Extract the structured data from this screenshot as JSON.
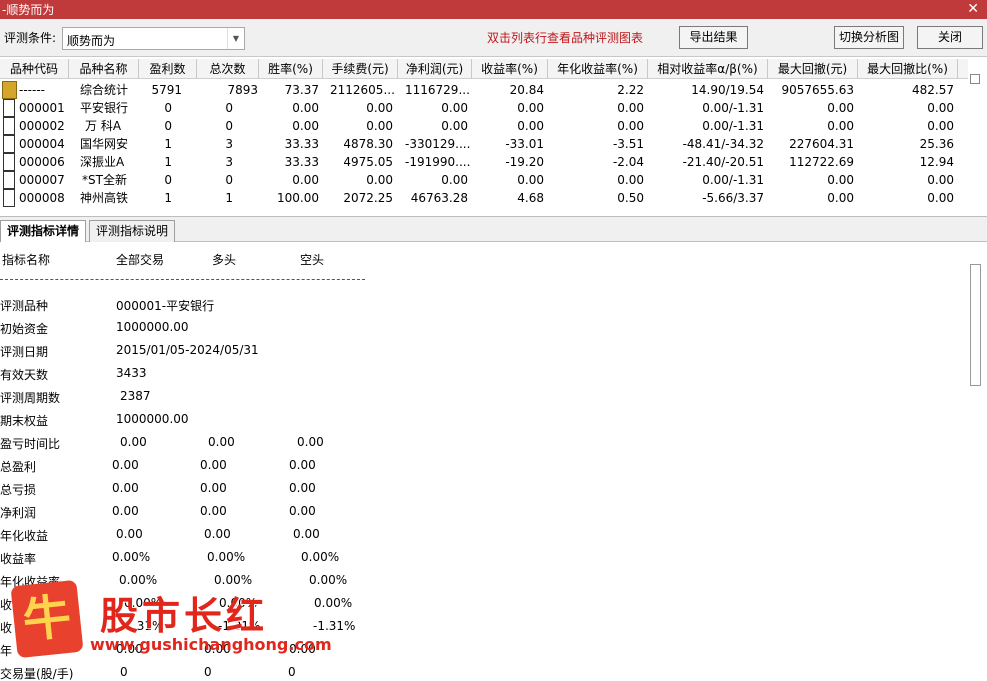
{
  "window": {
    "title": "-顺势而为",
    "close_glyph": "✕"
  },
  "toolbar": {
    "condition_label": "评测条件:",
    "condition_value": "顺势而为",
    "hint": "双击列表行查看品种评测图表",
    "export_button": "导出结果",
    "switch_button": "切换分析图",
    "close_button": "关闭"
  },
  "grid": {
    "columns": [
      "品种代码",
      "品种名称",
      "盈利数",
      "总次数",
      "胜率(%)",
      "手续费(元)",
      "净利润(元)",
      "收益率(%)",
      "年化收益率(%)",
      "相对收益率α/β(%)",
      "最大回撤(元)",
      "最大回撤比(%)"
    ],
    "rows": [
      {
        "code": "------",
        "name": "综合统计",
        "win": "5791",
        "total": "7893",
        "rate": "73.37",
        "fee": "2112605...",
        "net": "1116729...",
        "ret": "20.84",
        "annual": "2.22",
        "alpha": "14.90/19.54",
        "dd": "9057655.63",
        "ddr": "482.57",
        "icon": "folder-icon"
      },
      {
        "code": "000001",
        "name": "平安银行",
        "win": "0",
        "total": "0",
        "rate": "0.00",
        "fee": "0.00",
        "net": "0.00",
        "ret": "0.00",
        "annual": "0.00",
        "alpha": "0.00/-1.31",
        "dd": "0.00",
        "ddr": "0.00",
        "icon": "document-icon"
      },
      {
        "code": "000002",
        "name": "万 科A",
        "win": "0",
        "total": "0",
        "rate": "0.00",
        "fee": "0.00",
        "net": "0.00",
        "ret": "0.00",
        "annual": "0.00",
        "alpha": "0.00/-1.31",
        "dd": "0.00",
        "ddr": "0.00",
        "icon": "document-icon"
      },
      {
        "code": "000004",
        "name": "国华网安",
        "win": "1",
        "total": "3",
        "rate": "33.33",
        "fee": "4878.30",
        "net": "-330129....",
        "ret": "-33.01",
        "annual": "-3.51",
        "alpha": "-48.41/-34.32",
        "dd": "227604.31",
        "ddr": "25.36",
        "icon": "document-icon"
      },
      {
        "code": "000006",
        "name": "深振业A",
        "win": "1",
        "total": "3",
        "rate": "33.33",
        "fee": "4975.05",
        "net": "-191990....",
        "ret": "-19.20",
        "annual": "-2.04",
        "alpha": "-21.40/-20.51",
        "dd": "112722.69",
        "ddr": "12.94",
        "icon": "document-icon"
      },
      {
        "code": "000007",
        "name": "*ST全新",
        "win": "0",
        "total": "0",
        "rate": "0.00",
        "fee": "0.00",
        "net": "0.00",
        "ret": "0.00",
        "annual": "0.00",
        "alpha": "0.00/-1.31",
        "dd": "0.00",
        "ddr": "0.00",
        "icon": "document-icon"
      },
      {
        "code": "000008",
        "name": "神州高铁",
        "win": "1",
        "total": "1",
        "rate": "100.00",
        "fee": "2072.25",
        "net": "46763.28",
        "ret": "4.68",
        "annual": "0.50",
        "alpha": "-5.66/3.37",
        "dd": "0.00",
        "ddr": "0.00",
        "icon": "document-icon"
      }
    ]
  },
  "tabs": {
    "detail": "评测指标详情",
    "explain": "评测指标说明"
  },
  "detail": {
    "headers": {
      "name": "指标名称",
      "all": "全部交易",
      "long": "多头",
      "short": "空头"
    },
    "rows": [
      {
        "label": "评测品种",
        "all": "000001-平安银行",
        "long": "",
        "short": ""
      },
      {
        "label": "初始资金",
        "all": "1000000.00",
        "long": "",
        "short": ""
      },
      {
        "label": "评测日期",
        "all": "2015/01/05-2024/05/31",
        "long": "",
        "short": ""
      },
      {
        "label": "有效天数",
        "all": "3433",
        "long": "",
        "short": ""
      },
      {
        "label": "评测周期数",
        "all": "2387",
        "long": "",
        "short": ""
      },
      {
        "label": "期末权益",
        "all": "1000000.00",
        "long": "",
        "short": ""
      },
      {
        "label": "盈亏时间比",
        "all": "0.00",
        "long": "0.00",
        "short": "0.00"
      },
      {
        "label": "总盈利",
        "all": "0.00",
        "long": "0.00",
        "short": "0.00"
      },
      {
        "label": "总亏损",
        "all": "0.00",
        "long": "0.00",
        "short": "0.00"
      },
      {
        "label": "净利润",
        "all": "0.00",
        "long": "0.00",
        "short": "0.00"
      },
      {
        "label": "年化收益",
        "all": "0.00",
        "long": "0.00",
        "short": "0.00"
      },
      {
        "label": "收益率",
        "all": "0.00%",
        "long": "0.00%",
        "short": "0.00%"
      },
      {
        "label": "年化收益率",
        "all": "0.00%",
        "long": "0.00%",
        "short": "0.00%"
      },
      {
        "label": "收",
        "all": "0.00%",
        "long": "0.00%",
        "short": "0.00%"
      },
      {
        "label": "收",
        "all": "-1.31%",
        "long": "-1.31%",
        "short": "-1.31%"
      },
      {
        "label": "年",
        "all": "0.00",
        "long": "0.00",
        "short": "0.00"
      },
      {
        "label": "交易量(股/手)",
        "all": "0",
        "long": "0",
        "short": "0"
      }
    ]
  },
  "watermark": {
    "badge": "牛",
    "title": "股市长红",
    "url": "www.gushichanghong.com"
  }
}
